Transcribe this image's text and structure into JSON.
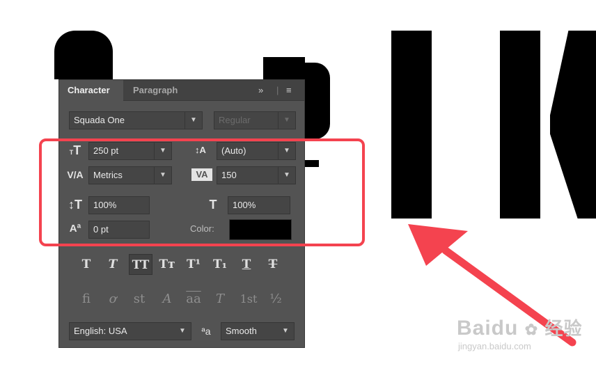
{
  "canvas": {
    "letters": [
      "S",
      "P",
      "I",
      "K"
    ],
    "text_color": "#000000"
  },
  "panel": {
    "tabs": [
      {
        "label": "Character",
        "active": true
      },
      {
        "label": "Paragraph",
        "active": false
      }
    ],
    "menu_icons": {
      "expand": "»",
      "menu": "≡"
    },
    "font_family": "Squada One",
    "font_style": "Regular",
    "font_size": "250 pt",
    "leading": "(Auto)",
    "kerning": "Metrics",
    "tracking": "150",
    "vertical_scale": "100%",
    "horizontal_scale": "100%",
    "baseline_shift": "0 pt",
    "color_label": "Color:",
    "color_value": "#000000",
    "type_style_buttons": [
      {
        "name": "faux-bold",
        "glyph": "T"
      },
      {
        "name": "faux-italic",
        "glyph": "T"
      },
      {
        "name": "all-caps",
        "glyph": "TT",
        "pressed": true
      },
      {
        "name": "small-caps",
        "glyph": "Tт"
      },
      {
        "name": "superscript",
        "glyph": "T¹"
      },
      {
        "name": "subscript",
        "glyph": "T₁"
      },
      {
        "name": "underline",
        "glyph": "T"
      },
      {
        "name": "strikethrough",
        "glyph": "T"
      }
    ],
    "opentype_buttons": [
      {
        "name": "ligatures",
        "glyph": "fi"
      },
      {
        "name": "contextual-alternates",
        "glyph": "ơ"
      },
      {
        "name": "discretionary-ligatures",
        "glyph": "st"
      },
      {
        "name": "swash",
        "glyph": "A"
      },
      {
        "name": "titling-alternates",
        "glyph": "aa"
      },
      {
        "name": "stylistic-alternates",
        "glyph": "T"
      },
      {
        "name": "ordinals",
        "glyph": "1st"
      },
      {
        "name": "fractions",
        "glyph": "½"
      }
    ],
    "language": "English: USA",
    "aa_icon": "ªa",
    "antialias": "Smooth"
  },
  "annotation": {
    "box_color": "#f4434f",
    "arrow_color": "#f4434f"
  },
  "watermark": {
    "brand": "Baidu",
    "chinese": "经验",
    "url": "jingyan.baidu.com"
  }
}
